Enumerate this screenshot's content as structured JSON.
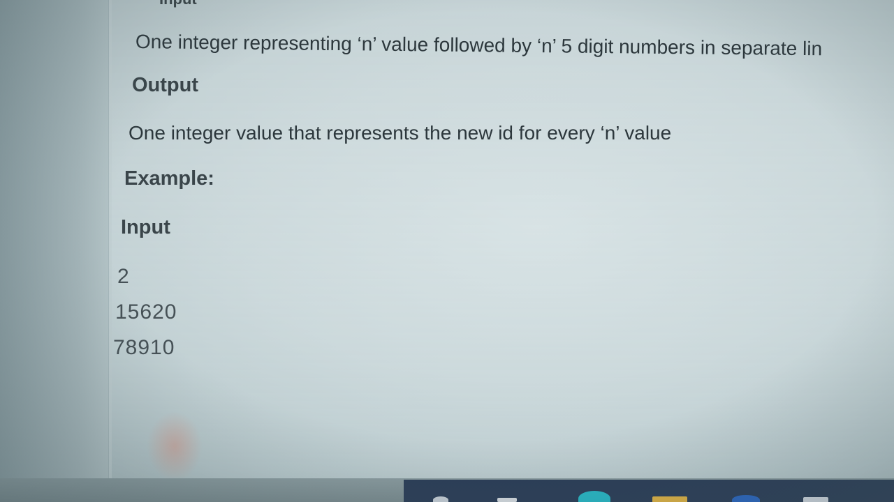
{
  "document": {
    "input_format_heading": "Input",
    "input_format_text": "One integer representing ‘n’ value followed by ‘n’ 5 digit numbers in separate lin",
    "output_heading": "Output",
    "output_text": "One integer value that represents the new id for every ‘n’ value",
    "example_heading": "Example:",
    "example_input_heading": "Input",
    "example_input_lines": [
      "2",
      "15620",
      "78910"
    ]
  },
  "taskbar": {
    "icons": [
      "windows-icon",
      "task-view-icon",
      "edge-browser-icon",
      "file-explorer-icon",
      "chrome-icon",
      "app-icon"
    ]
  },
  "colors": {
    "text": "#2f3a40",
    "taskbar": "#2b3d57"
  }
}
